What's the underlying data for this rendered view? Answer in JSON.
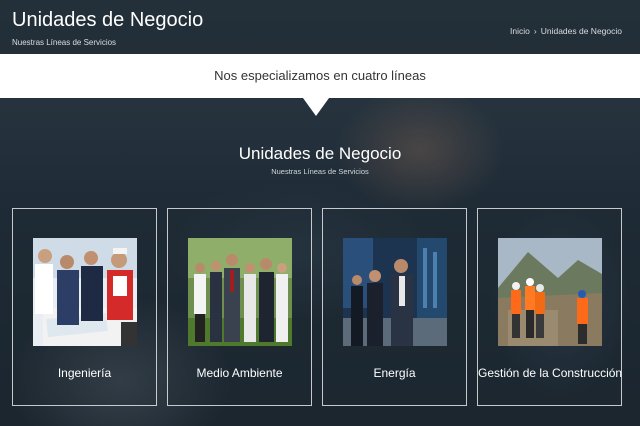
{
  "header": {
    "title": "Unidades de Negocio",
    "subtitle": "Nuestras Líneas de Servicios",
    "breadcrumb": [
      {
        "label": "Inicio"
      },
      {
        "label": "Unidades de Negocio"
      }
    ],
    "breadcrumb_separator": "›"
  },
  "banner": {
    "text": "Nos especializamos en cuatro líneas"
  },
  "section": {
    "title": "Unidades de Negocio",
    "subtitle": "Nuestras Líneas de Servicios"
  },
  "cards": [
    {
      "label": "Ingeniería",
      "image": "engineering-team-photo"
    },
    {
      "label": "Medio Ambiente",
      "image": "environment-team-photo"
    },
    {
      "label": "Energía",
      "image": "energy-team-photo"
    },
    {
      "label": "Gestión de la Construcción",
      "image": "construction-workers-photo"
    }
  ]
}
